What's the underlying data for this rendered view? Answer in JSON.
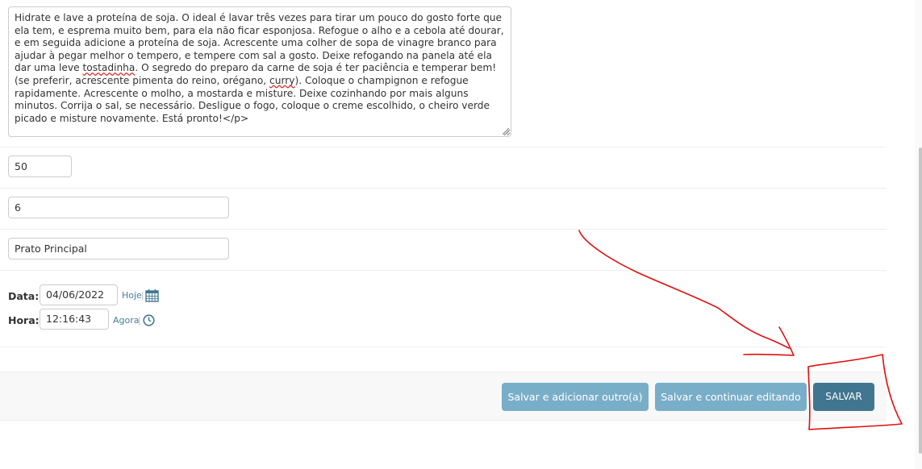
{
  "description": {
    "text_before_1": "Hidrate e lave a proteína de soja. O ideal é lavar três vezes para tirar um pouco do gosto forte que ela tem, e esprema muito bem, para ela não ficar esponjosa. Refogue o alho e a cebola até dourar, e em seguida adicione a proteína de soja. Acrescente uma colher de sopa de vinagre branco para ajudar à pegar melhor o tempero, e tempere com sal a gosto. Deixe refogando na panela até ela dar uma leve ",
    "spell_1": "tostadinha",
    "text_before_2": ". O segredo do preparo da carne de soja é ter paciência e temperar bem! (se preferir, acrescente pimenta do reino, orégano, ",
    "spell_2": "curry",
    "text_after": "). Coloque o champignon e refogue rapidamente. Acrescente o molho, a mostarda e misture. Deixe cozinhando por mais alguns minutos. Corrija o sal, se necessário. Desligue o fogo, coloque o creme escolhido, o cheiro verde picado e misture novamente. Está pronto!</p>"
  },
  "fields": {
    "time_minutes": "50",
    "servings": "6",
    "category": "Prato Principal"
  },
  "datetime": {
    "date_label": "Data:",
    "date_value": "04/06/2022",
    "today_link": "Hoje",
    "separator": "|",
    "time_label": "Hora:",
    "time_value": "12:16:43",
    "now_link": "Agora",
    "calendar_icon": "calendar-icon",
    "clock_icon": "clock-icon"
  },
  "buttons": {
    "save_add_another": "Salvar e adicionar outro(a)",
    "save_continue": "Salvar e continuar editando",
    "save": "SALVAR"
  },
  "colors": {
    "primary_button": "#417690",
    "secondary_button": "#79aec8",
    "link": "#447e9b",
    "annotation": "#e01010"
  }
}
